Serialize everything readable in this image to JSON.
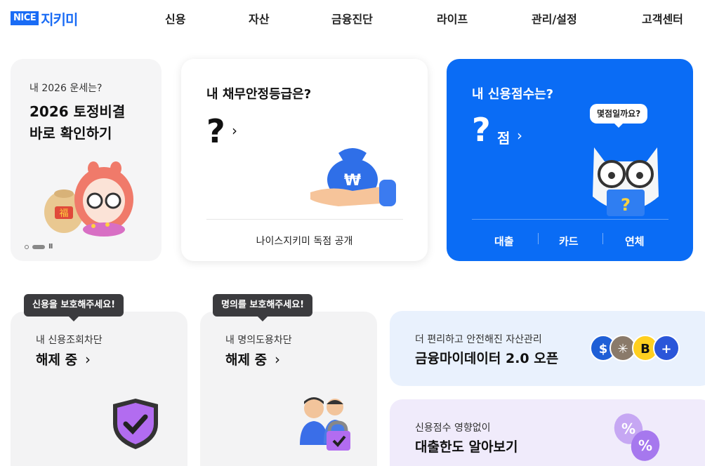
{
  "header": {
    "logo_nice": "NICE",
    "logo_jikimi": "지키미",
    "nav": [
      "신용",
      "자산",
      "금융진단",
      "라이프",
      "관리/설정",
      "고객센터"
    ]
  },
  "fortune_card": {
    "small": "내 2026 운세는?",
    "line1": "2026 토정비결",
    "line2": "바로 확인하기",
    "pause": "II"
  },
  "debt_card": {
    "title": "내 채무안정등급은?",
    "value": "?",
    "footer": "나이스지키미 독점 공개"
  },
  "score_card": {
    "title": "내 신용점수는?",
    "value": "?",
    "unit": "점",
    "bubble": "몇점일까요?",
    "tabs": [
      "대출",
      "카드",
      "연체"
    ]
  },
  "credit_block_card": {
    "tooltip": "신용을 보호해주세요!",
    "small": "내 신용조회차단",
    "status": "해제 중"
  },
  "identity_block_card": {
    "tooltip": "명의를 보호해주세요!",
    "small": "내 명의도용차단",
    "status": "해제 중"
  },
  "mydata_card": {
    "small": "더 편리하고 안전해진 자산관리",
    "big": "금융마이데이터 2.0 오픈",
    "plus": "+"
  },
  "loan_limit_card": {
    "small": "신용점수 영향없이",
    "big": "대출한도 알아보기"
  },
  "colors": {
    "brand_blue": "#0a6cf5",
    "tooltip_bg": "#3b3b3e"
  }
}
